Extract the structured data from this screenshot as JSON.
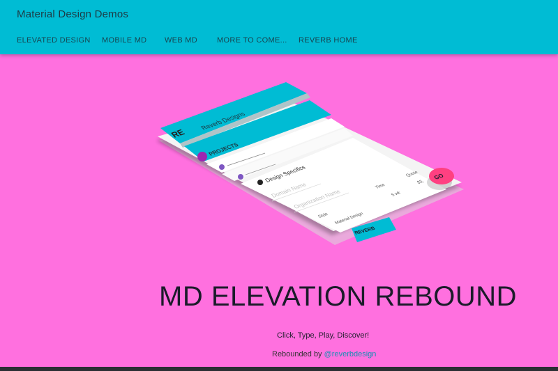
{
  "app": {
    "title": "Material Design Demos"
  },
  "nav": [
    {
      "label": "ELEVATED DESIGN"
    },
    {
      "label": "MOBILE MD"
    },
    {
      "label": "WEB MD"
    },
    {
      "label": "MORE TO COME..."
    },
    {
      "label": "REVERB HOME"
    }
  ],
  "mockup": {
    "header": "Reverb Designs",
    "logo": "RE",
    "section_title": "PROJECTS",
    "card_title": "Design Specifics",
    "domain_placeholder": "Domain Name",
    "org_placeholder": "Organization Name",
    "style_label": "Style",
    "style_value": "Material Design",
    "time_label": "Time",
    "time_value": "5 wk",
    "quote_label": "Quote",
    "quote_value": "$3,",
    "go_label": "GO",
    "footer_logo": "REVERB",
    "accent": "#00bcd4",
    "go_color": "#ff4081"
  },
  "headline": "MD ELEVATION REBOUND",
  "tagline": "Click, Type, Play, Discover!",
  "credit": {
    "prefix": "Rebounded by ",
    "handle": "@reverbdesign"
  },
  "colors": {
    "background": "#ff70df",
    "appbar": "#00bcd4"
  }
}
